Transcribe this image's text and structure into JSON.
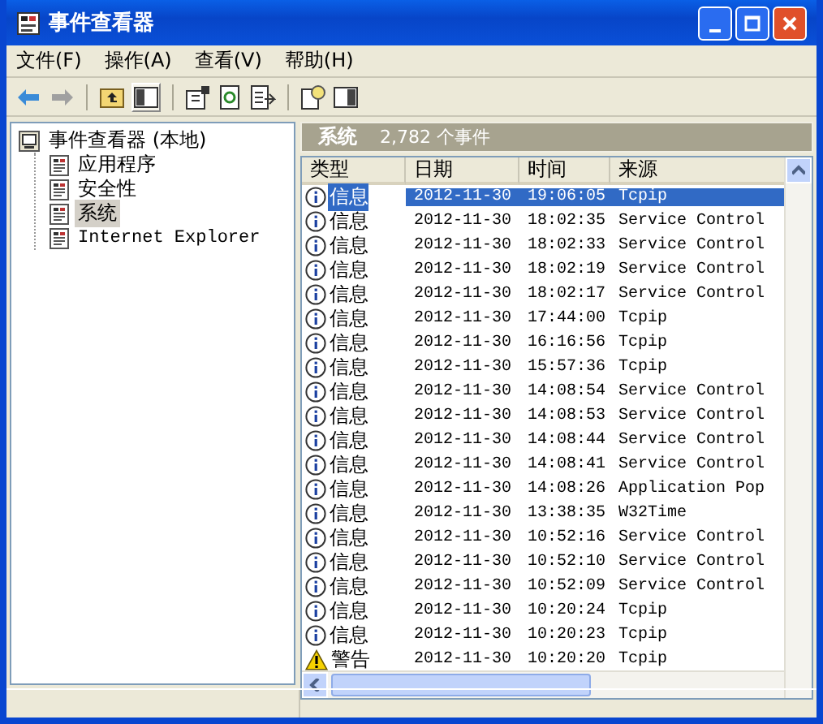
{
  "window": {
    "title": "事件查看器"
  },
  "menu": [
    "文件(F)",
    "操作(A)",
    "查看(V)",
    "帮助(H)"
  ],
  "tree": {
    "label": "事件查看器 (本地)",
    "children": [
      {
        "label": "应用程序",
        "selected": false
      },
      {
        "label": "安全性",
        "selected": false
      },
      {
        "label": "系统",
        "selected": true
      },
      {
        "label": "Internet Explorer",
        "selected": false
      }
    ]
  },
  "pane": {
    "title": "系统",
    "count": "2,782 个事件"
  },
  "columns": [
    "类型",
    "日期",
    "时间",
    "来源"
  ],
  "rows": [
    {
      "kind": "info",
      "type": "信息",
      "date": "2012-11-30",
      "time": "19:06:05",
      "source": "Tcpip",
      "selected": true
    },
    {
      "kind": "info",
      "type": "信息",
      "date": "2012-11-30",
      "time": "18:02:35",
      "source": "Service Control",
      "selected": false
    },
    {
      "kind": "info",
      "type": "信息",
      "date": "2012-11-30",
      "time": "18:02:33",
      "source": "Service Control",
      "selected": false
    },
    {
      "kind": "info",
      "type": "信息",
      "date": "2012-11-30",
      "time": "18:02:19",
      "source": "Service Control",
      "selected": false
    },
    {
      "kind": "info",
      "type": "信息",
      "date": "2012-11-30",
      "time": "18:02:17",
      "source": "Service Control",
      "selected": false
    },
    {
      "kind": "info",
      "type": "信息",
      "date": "2012-11-30",
      "time": "17:44:00",
      "source": "Tcpip",
      "selected": false
    },
    {
      "kind": "info",
      "type": "信息",
      "date": "2012-11-30",
      "time": "16:16:56",
      "source": "Tcpip",
      "selected": false
    },
    {
      "kind": "info",
      "type": "信息",
      "date": "2012-11-30",
      "time": "15:57:36",
      "source": "Tcpip",
      "selected": false
    },
    {
      "kind": "info",
      "type": "信息",
      "date": "2012-11-30",
      "time": "14:08:54",
      "source": "Service Control",
      "selected": false
    },
    {
      "kind": "info",
      "type": "信息",
      "date": "2012-11-30",
      "time": "14:08:53",
      "source": "Service Control",
      "selected": false
    },
    {
      "kind": "info",
      "type": "信息",
      "date": "2012-11-30",
      "time": "14:08:44",
      "source": "Service Control",
      "selected": false
    },
    {
      "kind": "info",
      "type": "信息",
      "date": "2012-11-30",
      "time": "14:08:41",
      "source": "Service Control",
      "selected": false
    },
    {
      "kind": "info",
      "type": "信息",
      "date": "2012-11-30",
      "time": "14:08:26",
      "source": "Application Pop",
      "selected": false
    },
    {
      "kind": "info",
      "type": "信息",
      "date": "2012-11-30",
      "time": "13:38:35",
      "source": "W32Time",
      "selected": false
    },
    {
      "kind": "info",
      "type": "信息",
      "date": "2012-11-30",
      "time": "10:52:16",
      "source": "Service Control",
      "selected": false
    },
    {
      "kind": "info",
      "type": "信息",
      "date": "2012-11-30",
      "time": "10:52:10",
      "source": "Service Control",
      "selected": false
    },
    {
      "kind": "info",
      "type": "信息",
      "date": "2012-11-30",
      "time": "10:52:09",
      "source": "Service Control",
      "selected": false
    },
    {
      "kind": "info",
      "type": "信息",
      "date": "2012-11-30",
      "time": "10:20:24",
      "source": "Tcpip",
      "selected": false
    },
    {
      "kind": "info",
      "type": "信息",
      "date": "2012-11-30",
      "time": "10:20:23",
      "source": "Tcpip",
      "selected": false
    },
    {
      "kind": "warning",
      "type": "警告",
      "date": "2012-11-30",
      "time": "10:20:20",
      "source": "Tcpip",
      "selected": false
    }
  ]
}
